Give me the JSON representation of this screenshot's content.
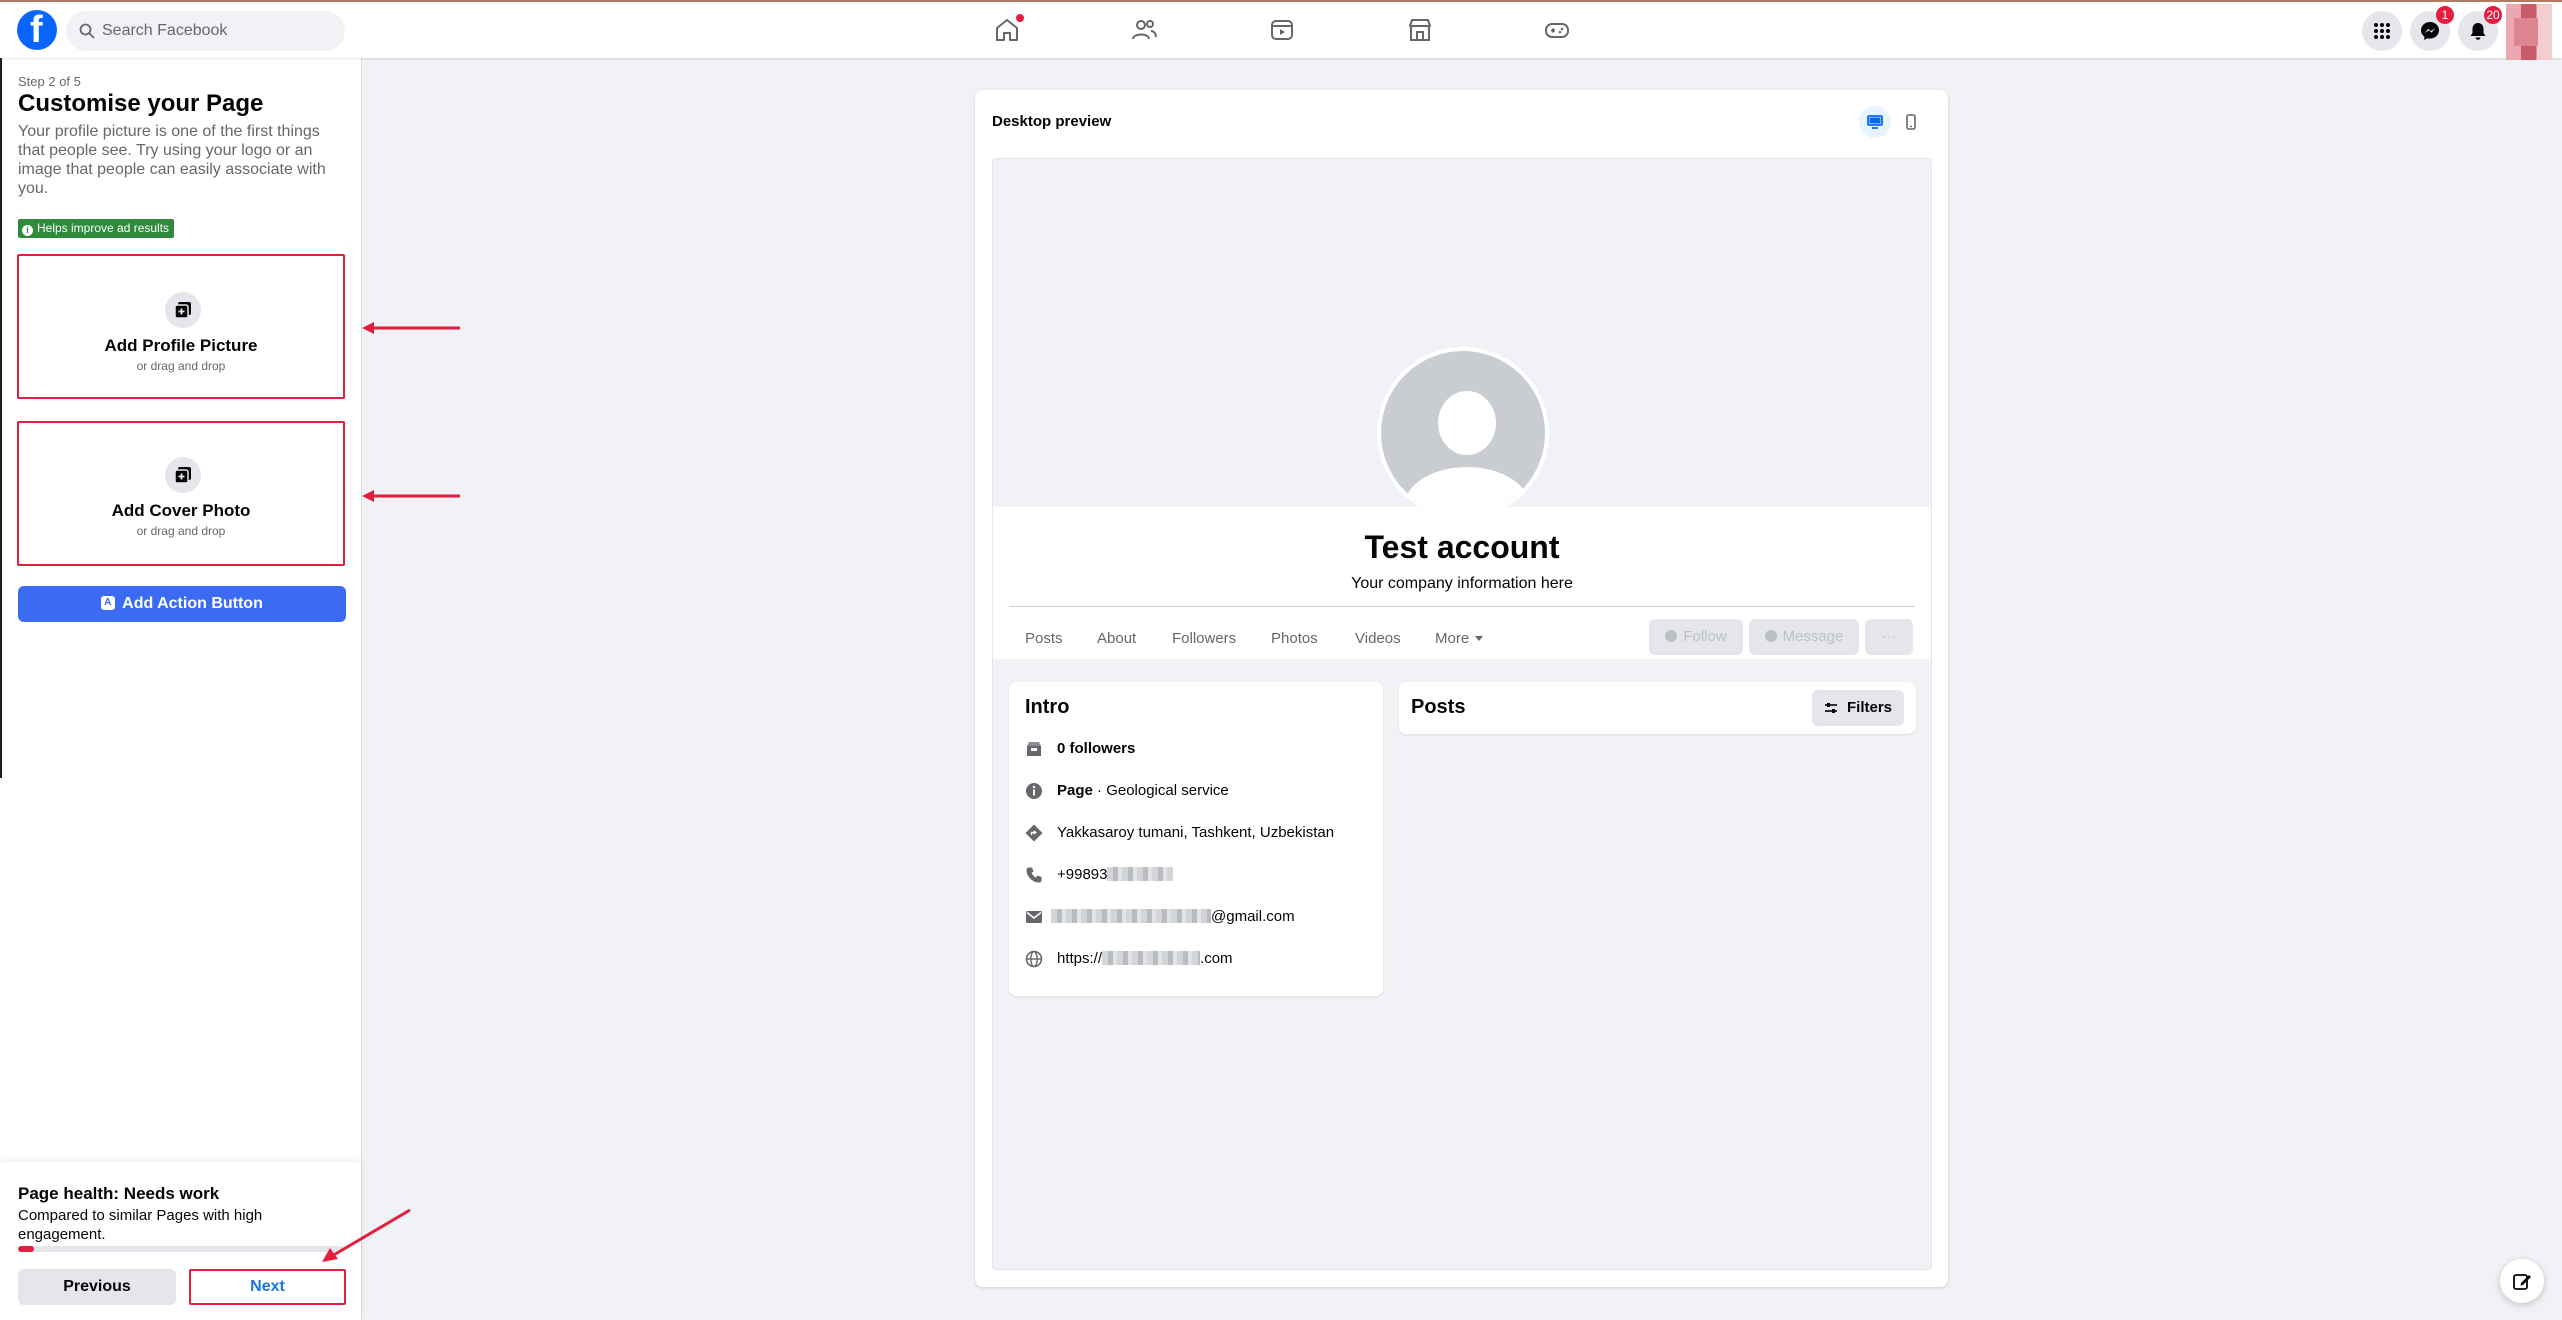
{
  "topbar": {
    "logo_letter": "f",
    "search_placeholder": "Search Facebook",
    "nav_icons": [
      "home-icon",
      "friends-icon",
      "watch-icon",
      "marketplace-icon",
      "gaming-icon"
    ],
    "messenger_badge": "1",
    "notifications_badge": "20"
  },
  "left_panel": {
    "step": "Step 2 of 5",
    "title": "Customise your Page",
    "description": "Your profile picture is one of the first things that people see. Try using your logo or an image that people can easily associate with you.",
    "ad_badge": "Helps improve ad results",
    "profile_upload": {
      "label": "Add Profile Picture",
      "sub": "or drag and drop"
    },
    "cover_upload": {
      "label": "Add Cover Photo",
      "sub": "or drag and drop"
    },
    "action_button": "Add Action Button"
  },
  "health": {
    "title": "Page health: Needs work",
    "description": "Compared to similar Pages with high engagement.",
    "progress_fraction": 0.05,
    "previous": "Previous",
    "next": "Next"
  },
  "preview": {
    "title": "Desktop preview",
    "page_name": "Test account",
    "page_subtitle": "Your company information here",
    "tabs": [
      "Posts",
      "About",
      "Followers",
      "Photos",
      "Videos",
      "More"
    ],
    "follow": "Follow",
    "message": "Message",
    "more_actions": "···",
    "intro": {
      "title": "Intro",
      "followers": "0 followers",
      "page_label": "Page",
      "category": " · Geological service",
      "location": "Yakkasaroy tumani, Tashkent, Uzbekistan",
      "phone_prefix": "+99893",
      "email_suffix": "@gmail.com",
      "website_prefix": "https://",
      "website_suffix": ".com"
    },
    "posts": {
      "title": "Posts",
      "filters": "Filters"
    }
  },
  "colors": {
    "brand": "#0866FF",
    "annotation_red": "#E41E3F",
    "action_blue": "#3B6BF2",
    "badge_green": "#2E8B3B"
  }
}
